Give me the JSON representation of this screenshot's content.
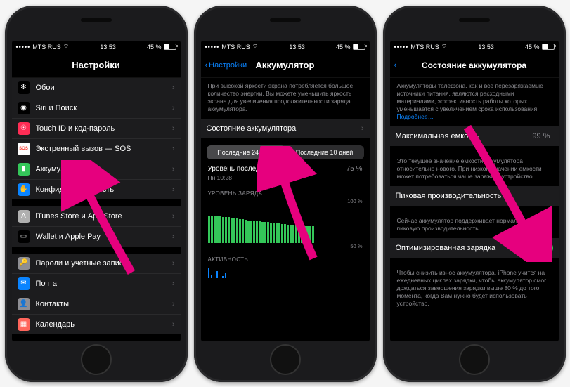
{
  "status": {
    "carrier": "MTS RUS",
    "wifi_icon": "wifi-icon",
    "time": "13:53",
    "battery_pct": "45 %"
  },
  "phone1": {
    "title": "Настройки",
    "group1": [
      {
        "icon_bg": "#000",
        "glyph": "✻",
        "label": "Обои"
      },
      {
        "icon_bg": "#000",
        "glyph": "◉",
        "label": "Siri и Поиск"
      },
      {
        "icon_bg": "#ff2d55",
        "glyph": "☉",
        "label": "Touch ID и код-пароль"
      },
      {
        "icon_bg": "#ffffff",
        "glyph": "SOS",
        "glyph_color": "#ff3b30",
        "label": "Экстренный вызов — SOS"
      },
      {
        "icon_bg": "#34c759",
        "glyph": "▮",
        "label": "Аккумулятор"
      },
      {
        "icon_bg": "#0a84ff",
        "glyph": "✋",
        "label": "Конфиденциальность"
      }
    ],
    "group2": [
      {
        "icon_bg": "#afafaf",
        "glyph": "A",
        "label": "iTunes Store и App Store"
      },
      {
        "icon_bg": "#000",
        "glyph": "▭",
        "label": "Wallet и Apple Pay"
      }
    ],
    "group3": [
      {
        "icon_bg": "#8e8e93",
        "glyph": "🔑",
        "label": "Пароли и учетные записи"
      },
      {
        "icon_bg": "#0a84ff",
        "glyph": "✉",
        "label": "Почта"
      },
      {
        "icon_bg": "#8e8e93",
        "glyph": "👤",
        "label": "Контакты"
      },
      {
        "icon_bg": "#ff655b",
        "glyph": "▦",
        "label": "Календарь"
      }
    ]
  },
  "phone2": {
    "back": "Настройки",
    "title": "Аккумулятор",
    "intro": "При высокой яркости экрана потребляется большое количество энергии. Вы можете уменьшить яркость экрана для увеличения продолжительности заряда аккумулятора.",
    "battery_health_label": "Состояние аккумулятора",
    "seg_a": "Последние 24 часа",
    "seg_b": "Последние 10 дней",
    "last_charge_label": "Уровень последнего заряда",
    "last_charge_value": "75 %",
    "last_charge_time": "Пн 10:28",
    "charge_level_label": "УРОВЕНЬ ЗАРЯДА",
    "scale_100": "100 %",
    "scale_50": "50 %",
    "activity_label": "АКТИВНОСТЬ",
    "chart_data": {
      "type": "bar",
      "title": "Уровень заряда (24 ч)",
      "ylim": [
        0,
        100
      ],
      "values": [
        75,
        75,
        74,
        73,
        72,
        71,
        71,
        70,
        69,
        67,
        66,
        65,
        64,
        63,
        62,
        61,
        60,
        60,
        59,
        58,
        58,
        57,
        56,
        55,
        55,
        54,
        52,
        51,
        50,
        49,
        49,
        48,
        48,
        47,
        46,
        46,
        45,
        45
      ],
      "activity_minutes": [
        12,
        4,
        0,
        8,
        0,
        2,
        6
      ]
    }
  },
  "phone3": {
    "back_icon": "chevron-left-icon",
    "title": "Состояние аккумулятора",
    "intro": "Аккумуляторы телефона, как и все перезаряжаемые источники питания, являются расходными материалами, эффективность работы которых уменьшается с увеличением срока использования.",
    "learn_more": "Подробнее…",
    "max_cap_label": "Максимальная емкость",
    "max_cap_value": "99 %",
    "max_cap_footer": "Это текущее значение емкости аккумулятора относительно нового. При низком значении емкости может потребоваться чаще заряжать устройство.",
    "peak_label": "Пиковая производительность",
    "peak_footer": "Сейчас аккумулятор поддерживает нормальную пиковую производительность.",
    "opt_label": "Оптимизированная зарядка",
    "opt_on": true,
    "opt_footer": "Чтобы снизить износ аккумулятора, iPhone учится на ежедневных циклах зарядки, чтобы аккумулятор смог дождаться завершения зарядки выше 80 % до того момента, когда Вам нужно будет использовать устройство."
  },
  "arrow_color": "#e6007e"
}
